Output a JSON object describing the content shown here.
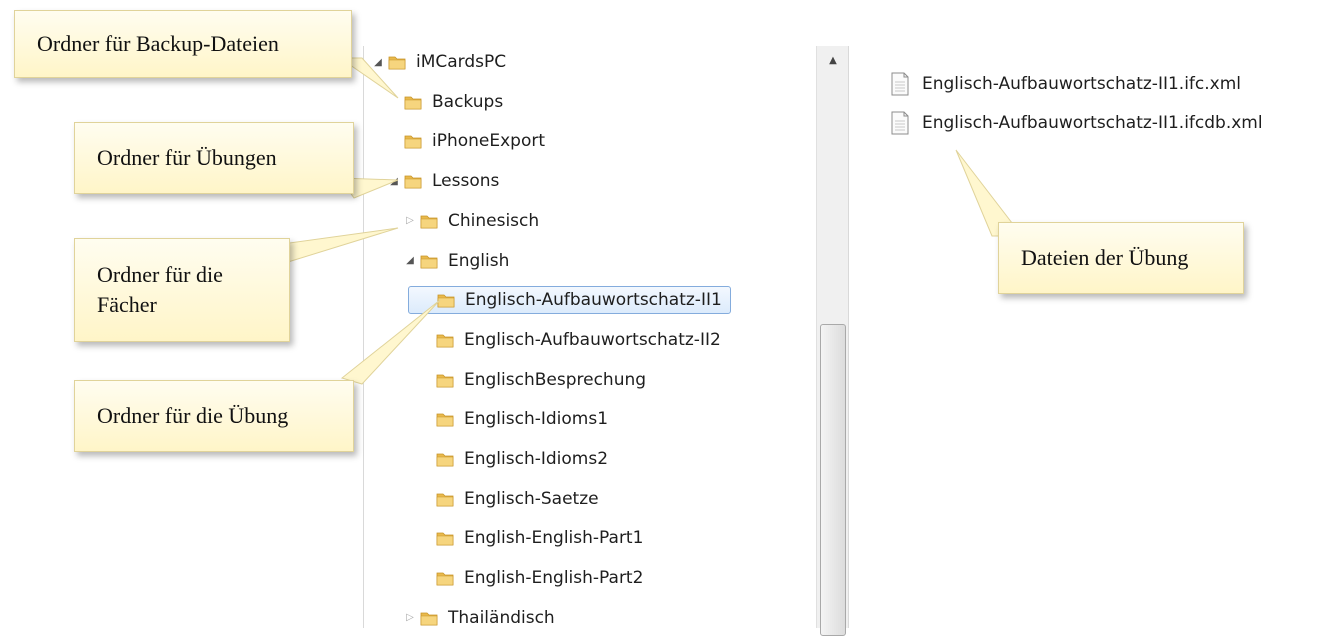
{
  "tree": {
    "items": [
      {
        "label": "iMCardsPC",
        "expander": "expanded"
      },
      {
        "label": "Backups",
        "expander": "none"
      },
      {
        "label": "iPhoneExport",
        "expander": "none"
      },
      {
        "label": "Lessons",
        "expander": "expanded"
      },
      {
        "label": "Chinesisch",
        "expander": "collapsed"
      },
      {
        "label": "English",
        "expander": "expanded"
      },
      {
        "label": "Englisch-Aufbauwortschatz-II1",
        "expander": "none",
        "selected": true
      },
      {
        "label": "Englisch-Aufbauwortschatz-II2",
        "expander": "none"
      },
      {
        "label": "EnglischBesprechung",
        "expander": "none"
      },
      {
        "label": "Englisch-Idioms1",
        "expander": "none"
      },
      {
        "label": "Englisch-Idioms2",
        "expander": "none"
      },
      {
        "label": "Englisch-Saetze",
        "expander": "none"
      },
      {
        "label": "English-English-Part1",
        "expander": "none"
      },
      {
        "label": "English-English-Part2",
        "expander": "none"
      },
      {
        "label": "Thailändisch",
        "expander": "collapsed"
      }
    ],
    "expander_glyphs": {
      "expanded": "◢",
      "collapsed": "▷",
      "none": ""
    }
  },
  "files": [
    {
      "name": "Englisch-Aufbauwortschatz-II1.ifc.xml"
    },
    {
      "name": "Englisch-Aufbauwortschatz-II1.ifcdb.xml"
    }
  ],
  "scrollbar": {
    "up_glyph": "▲"
  },
  "callouts": {
    "backup": "Ordner für Backup-Dateien",
    "uebungen": "Ordner für Übungen",
    "faecher_line1": "Ordner für die",
    "faecher_line2": "Fächer",
    "uebung": "Ordner für die Übung",
    "dateien": "Dateien der Übung"
  },
  "colors": {
    "callout_fill": "#fff8d6",
    "selection_border": "#84acdd",
    "folder": "#e8b84a"
  },
  "icons": {
    "folder": "folder-icon",
    "file": "xml-file-icon"
  }
}
